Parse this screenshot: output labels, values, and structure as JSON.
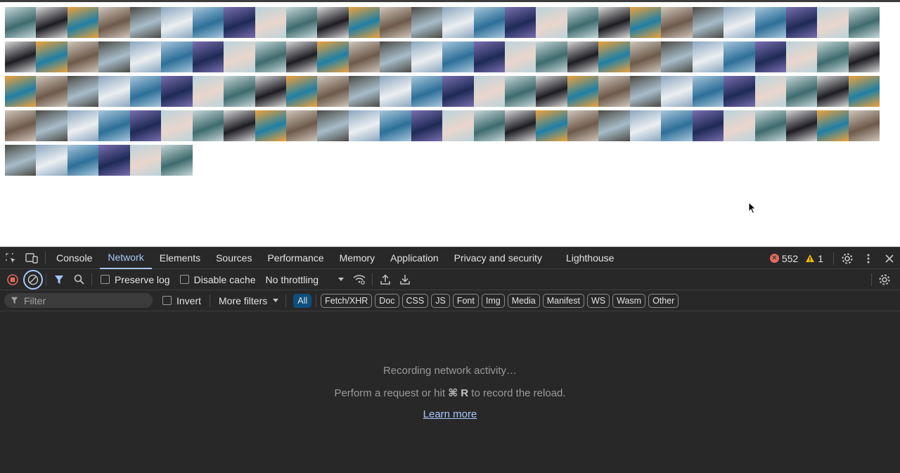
{
  "thumbnails": {
    "count": 118,
    "palette": [
      {
        "a": "#3e6b6e",
        "b": "#c7d7d8"
      },
      {
        "a": "#1c1c22",
        "b": "#d8d8d8"
      },
      {
        "a": "#1f7fa5",
        "b": "#f0a23a"
      },
      {
        "a": "#6e5a4a",
        "b": "#cfc6bc"
      },
      {
        "a": "#a7bcc9",
        "b": "#4b4a44"
      },
      {
        "a": "#eceff1",
        "b": "#8aa6bf"
      },
      {
        "a": "#2d6f98",
        "b": "#a8c7dc"
      },
      {
        "a": "#1e2a55",
        "b": "#7a6fb0"
      },
      {
        "a": "#e9d6cc",
        "b": "#bcd3db"
      }
    ]
  },
  "devtools": {
    "tabs": [
      "Console",
      "Network",
      "Elements",
      "Sources",
      "Performance",
      "Memory",
      "Application",
      "Privacy and security",
      "Lighthouse"
    ],
    "active_tab": "Network",
    "error_count": "552",
    "warning_count": "1",
    "toolbar": {
      "preserve_log": "Preserve log",
      "disable_cache": "Disable cache",
      "throttling": "No throttling"
    },
    "filterbar": {
      "filter_placeholder": "Filter",
      "invert": "Invert",
      "more_filters": "More filters",
      "chips": [
        "All",
        "Fetch/XHR",
        "Doc",
        "CSS",
        "JS",
        "Font",
        "Img",
        "Media",
        "Manifest",
        "WS",
        "Wasm",
        "Other"
      ],
      "active_chip": "All"
    },
    "empty_state": {
      "line1": "Recording network activity…",
      "line2_prefix": "Perform a request or hit",
      "shortcut": "⌘ R",
      "line2_suffix": "to record the reload.",
      "learn_more": "Learn more"
    }
  }
}
